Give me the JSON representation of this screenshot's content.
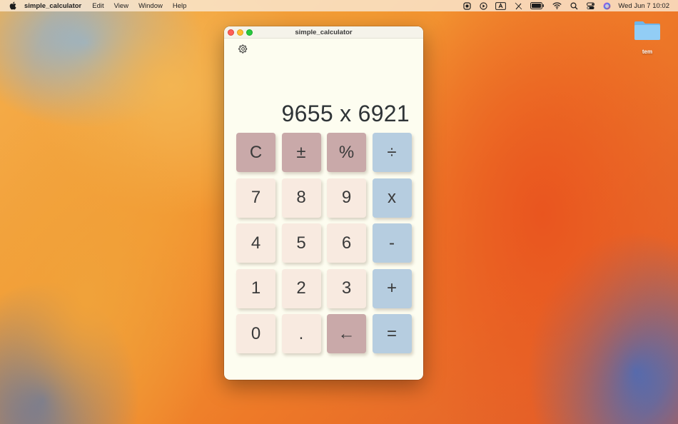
{
  "menubar": {
    "app_name": "simple_calculator",
    "items": [
      "Edit",
      "View",
      "Window",
      "Help"
    ],
    "clock": "Wed Jun 7  10:02"
  },
  "desktop": {
    "folder_label": "tem"
  },
  "window": {
    "title": "simple_calculator",
    "display": "9655 x 6921"
  },
  "keys": [
    {
      "label": "C",
      "type": "fn"
    },
    {
      "label": "±",
      "type": "fn"
    },
    {
      "label": "%",
      "type": "fn"
    },
    {
      "label": "÷",
      "type": "op"
    },
    {
      "label": "7",
      "type": "num"
    },
    {
      "label": "8",
      "type": "num"
    },
    {
      "label": "9",
      "type": "num"
    },
    {
      "label": "x",
      "type": "op"
    },
    {
      "label": "4",
      "type": "num"
    },
    {
      "label": "5",
      "type": "num"
    },
    {
      "label": "6",
      "type": "num"
    },
    {
      "label": "-",
      "type": "op"
    },
    {
      "label": "1",
      "type": "num"
    },
    {
      "label": "2",
      "type": "num"
    },
    {
      "label": "3",
      "type": "num"
    },
    {
      "label": "+",
      "type": "op"
    },
    {
      "label": "0",
      "type": "num"
    },
    {
      "label": ".",
      "type": "num"
    },
    {
      "label": "←",
      "type": "back"
    },
    {
      "label": "=",
      "type": "op"
    }
  ],
  "colors": {
    "fn_key": "#c9a9a9",
    "num_key": "#f8eae0",
    "op_key": "#b6cde0",
    "window_bg": "#fdfdf0"
  }
}
